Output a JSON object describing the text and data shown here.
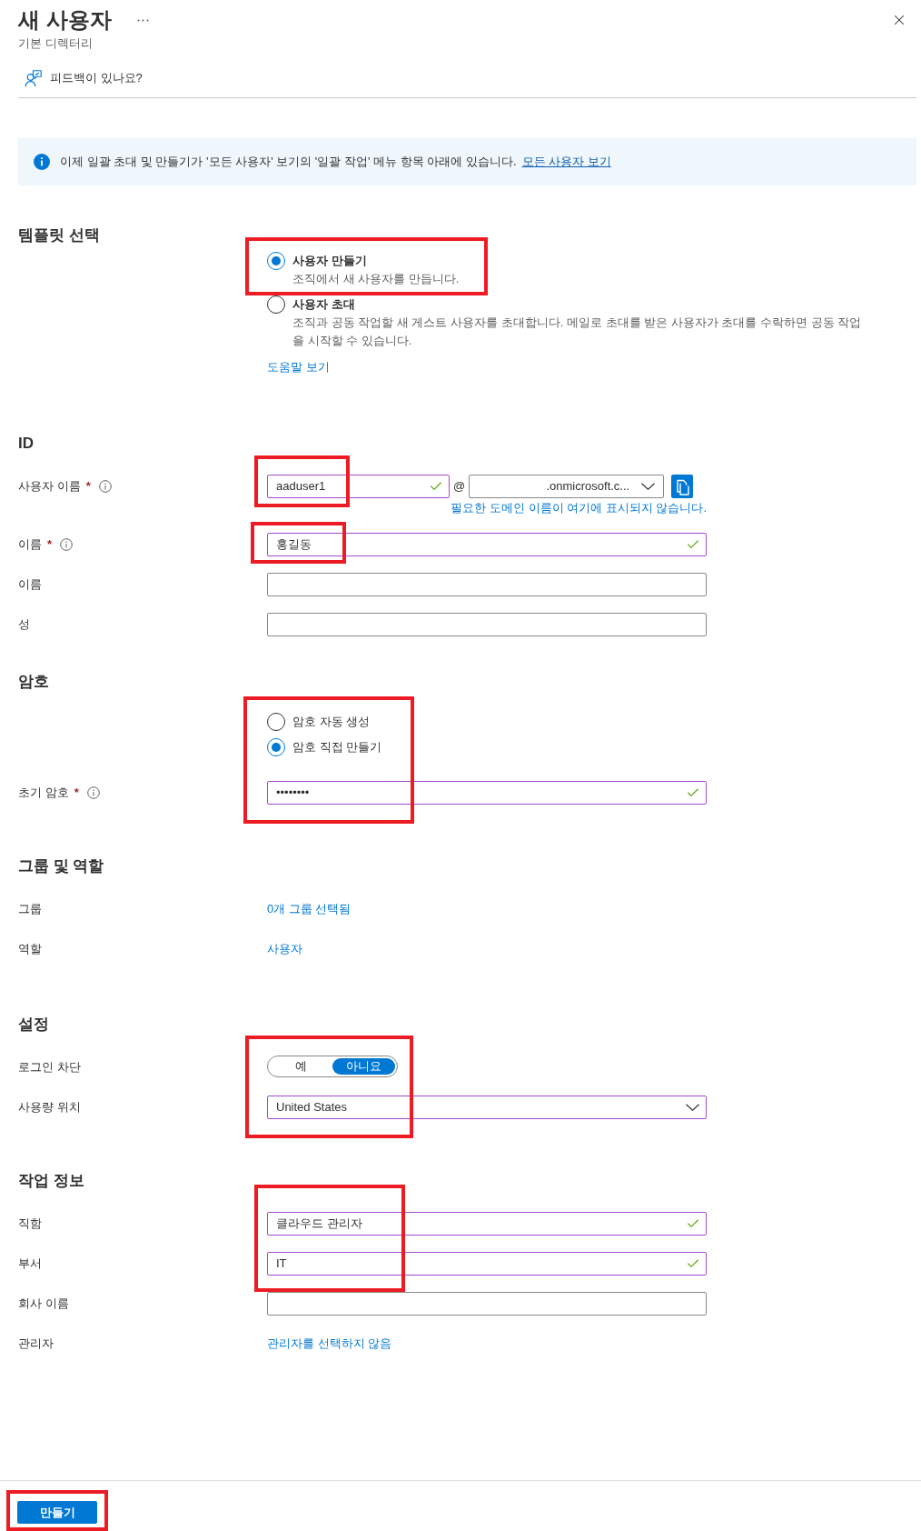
{
  "header": {
    "title": "새 사용자",
    "subtitle": "기본 디렉터리"
  },
  "feedback": {
    "label": "피드백이 있나요?"
  },
  "info_banner": {
    "text": "이제 일괄 초대 및 만들기가 '모든 사용자' 보기의 '일괄 작업' 메뉴 항목 아래에 있습니다.",
    "link": "모든 사용자 보기"
  },
  "sections": [
    {
      "heading": "템플릿 선택",
      "rows": [
        {
          "kind": "radio_cards",
          "options": [
            {
              "label": "사용자 만들기",
              "description": "조직에서 새 사용자를 만듭니다.",
              "selected": true,
              "highlighted": true
            },
            {
              "label": "사용자 초대",
              "description": "조직과 공동 작업할 새 게스트 사용자를 초대합니다. 메일로 초대를 받은 사용자가 초대를 수락하면 공동 작업을 시작할 수 있습니다.",
              "selected": false
            }
          ]
        },
        {
          "kind": "help_link",
          "link": "도움말 보기"
        }
      ]
    },
    {
      "heading": "ID",
      "rows": [
        {
          "kind": "username",
          "label": "사용자 이름",
          "required_mark": "*",
          "info": true,
          "value": "aaduser1",
          "validated": true,
          "at_sign": "@",
          "domain": ".onmicrosoft.c...",
          "hint": "필요한 도메인 이름이 여기에 표시되지 않습니다.",
          "highlighted": true
        },
        {
          "kind": "text",
          "label": "이름",
          "required_mark": "*",
          "info": true,
          "value": "홍길동",
          "validated": true,
          "highlighted": true
        },
        {
          "kind": "text",
          "label": "이름",
          "validated": false
        },
        {
          "kind": "text",
          "label": "성",
          "validated": false
        }
      ]
    },
    {
      "heading": "암호",
      "rows": [
        {
          "kind": "radios",
          "options": [
            {
              "label": "암호 자동 생성",
              "selected": false
            },
            {
              "label": "암호 직접 만들기",
              "selected": true
            }
          ],
          "highlighted": true
        },
        {
          "kind": "password",
          "label": "초기 암호",
          "required_mark": "*",
          "info": true,
          "value": "••••••••",
          "validated": true
        }
      ]
    },
    {
      "heading": "그룹 및 역할",
      "rows": [
        {
          "kind": "link",
          "label": "그룹",
          "link": "0개 그룹 선택됨"
        },
        {
          "kind": "link",
          "label": "역할",
          "link": "사용자"
        }
      ]
    },
    {
      "heading": "설정",
      "rows": [
        {
          "kind": "toggle",
          "label": "로그인 차단",
          "options": [
            {
              "label": "예",
              "selected": false
            },
            {
              "label": "아니요",
              "selected": true
            }
          ],
          "highlighted": true
        },
        {
          "kind": "dropdown",
          "label": "사용량 위치",
          "value": "United States",
          "validated": true
        }
      ]
    },
    {
      "heading": "작업 정보",
      "rows": [
        {
          "kind": "text",
          "label": "직함",
          "value": "클라우드 관리자",
          "validated": true,
          "highlighted": true
        },
        {
          "kind": "text",
          "label": "부서",
          "value": "IT",
          "validated": true
        },
        {
          "kind": "text",
          "label": "회사 이름",
          "validated": false
        },
        {
          "kind": "link",
          "label": "관리자",
          "link": "관리자를 선택하지 않음"
        }
      ]
    }
  ],
  "footer": {
    "create_button": "만들기",
    "highlighted": true
  }
}
